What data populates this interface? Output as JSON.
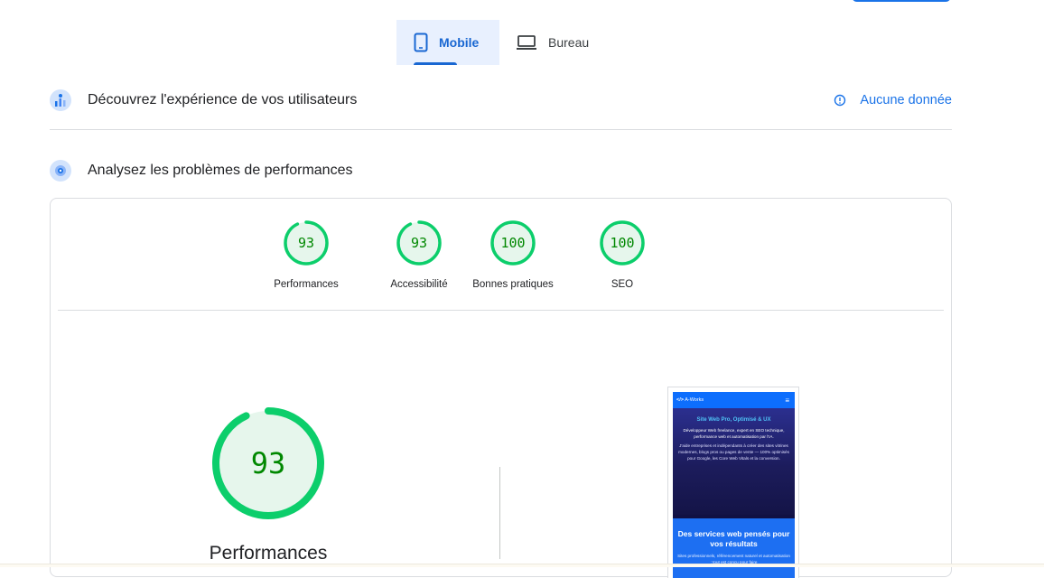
{
  "tabs": [
    {
      "label": "Mobile",
      "icon": "smartphone-icon",
      "active": true
    },
    {
      "label": "Bureau",
      "icon": "laptop-icon",
      "active": false
    }
  ],
  "crux": {
    "title": "Découvrez l'expérience de vos utilisateurs",
    "status": "Aucune donnée",
    "icon": "users-chart-icon"
  },
  "diagnose": {
    "title": "Analysez les problèmes de performances",
    "icon": "lighthouse-icon"
  },
  "scores": [
    {
      "label": "Performances",
      "value": "93",
      "fraction": 0.93
    },
    {
      "label": "Accessibilité",
      "value": "93",
      "fraction": 0.93
    },
    {
      "label": "Bonnes pratiques",
      "value": "100",
      "fraction": 1.0
    },
    {
      "label": "SEO",
      "value": "100",
      "fraction": 1.0
    }
  ],
  "main_gauge": {
    "value": "93",
    "fraction": 0.93,
    "label": "Performances"
  },
  "colors": {
    "pass": "#0cce6b",
    "pass_text": "#008800",
    "pass_bg": "#e6f6ec",
    "accent": "#1a73e8"
  },
  "screenshot": {
    "brand": "A-Works",
    "hero_title": "Site Web Pro, Optimisé & UX",
    "hero_text1": "Développeur Web freelance, expert en SEO technique, performance web et automatisation par l'IA.",
    "hero_text2": "J'aide entreprises et indépendants à créer des sites vitrines modernes, blogs pros ou pages de vente — 100% optimisés pour Google, les Core Web Vitals et la conversion.",
    "section_title": "Des services web pensés pour vos résultats",
    "section_text": "Sites professionnels, référencement naturel et automatisation : tout est conçu pour faire"
  }
}
